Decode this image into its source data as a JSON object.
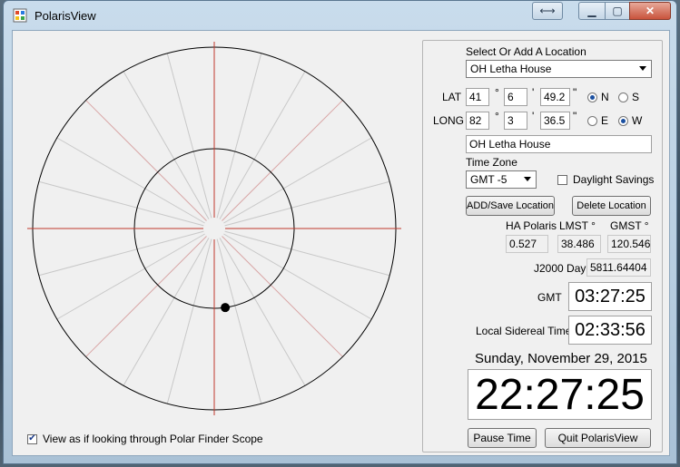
{
  "window": {
    "title": "PolarisView",
    "icons": {
      "app": "app-icon",
      "resize": "resize-arrows-icon",
      "minimize": "minimize-icon",
      "maximize": "maximize-icon",
      "close": "close-icon"
    }
  },
  "scope": {
    "view_checkbox_label": "View as if looking through Polar Finder Scope",
    "view_checked": true,
    "polaris_ha_fraction": 0.527
  },
  "location": {
    "select_label": "Select Or Add A Location",
    "selected": "OH Letha House",
    "lat_label": "LAT",
    "lat_deg": "41",
    "lat_min": "6",
    "lat_sec": "49.2",
    "long_label": "LONG",
    "long_deg": "82",
    "long_min": "3",
    "long_sec": "36.5",
    "deg_sym": "°",
    "min_sym": "'",
    "sec_sym": "\"",
    "n_label": "N",
    "s_label": "S",
    "e_label": "E",
    "w_label": "W",
    "lat_hemisphere": "N",
    "long_hemisphere": "W",
    "name_value": "OH Letha House"
  },
  "timezone": {
    "label": "Time Zone",
    "selected": "GMT -5",
    "dst_label": "Daylight Savings",
    "dst_checked": false
  },
  "buttons": {
    "add_save": "ADD/Save Location",
    "delete": "Delete Location",
    "pause": "Pause Time",
    "quit": "Quit PolarisView"
  },
  "readouts": {
    "ha_label": "HA Polaris",
    "ha_value": "0.527",
    "lmst_label": "LMST °",
    "lmst_value": "38.486",
    "gmst_label": "GMST °",
    "gmst_value": "120.546",
    "j2000_label": "J2000 Day",
    "j2000_value": "5811.64404",
    "gmt_label": "GMT",
    "gmt_value": "03:27:25",
    "lst_label": "Local Sidereal Time",
    "lst_value": "02:33:56",
    "date": "Sunday, November 29, 2015",
    "local_time": "22:27:25"
  },
  "colors": {
    "crosshair": "#c0392b",
    "ring": "#000000",
    "radial": "#c8c8c8",
    "polaris_dot": "#000000"
  }
}
